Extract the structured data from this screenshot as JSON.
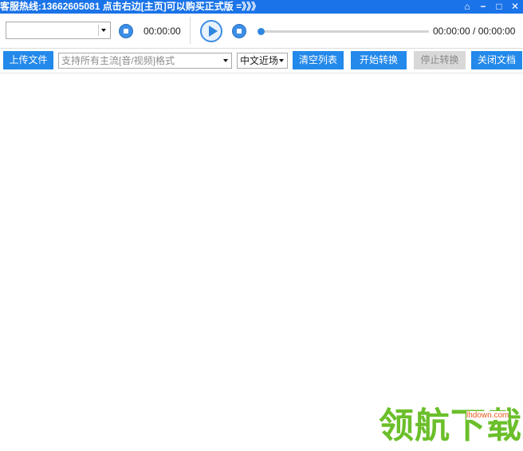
{
  "titlebar": {
    "title": "客服热线:13662605081  点击右边[主页]可以购买正式版 =》》》",
    "controls": [
      {
        "name": "home-icon",
        "glyph": "⌂"
      },
      {
        "name": "minimize-icon",
        "glyph": "−"
      },
      {
        "name": "maximize-icon",
        "glyph": "□"
      },
      {
        "name": "close-icon",
        "glyph": "✕"
      }
    ]
  },
  "player": {
    "current_time": "00:00:00",
    "progress_time": "00:00:00 / 00:00:00",
    "progress_fraction": 0
  },
  "toolbar": {
    "upload_label": "上传文件",
    "format_placeholder": "支持所有主流[音/视频]格式",
    "language_value": "中文近场",
    "clear_label": "清空列表",
    "start_label": "开始转换",
    "stop_label": "停止转换",
    "close_doc_label": "关闭文档"
  },
  "watermark": {
    "site": "lhdown.com",
    "brand": "领航下载"
  },
  "colors": {
    "titlebar_bg": "#1a73e8",
    "button_bg": "#2389ea",
    "button_disabled_bg": "#d8d8d8",
    "watermark_green": "#6bbf2a"
  }
}
